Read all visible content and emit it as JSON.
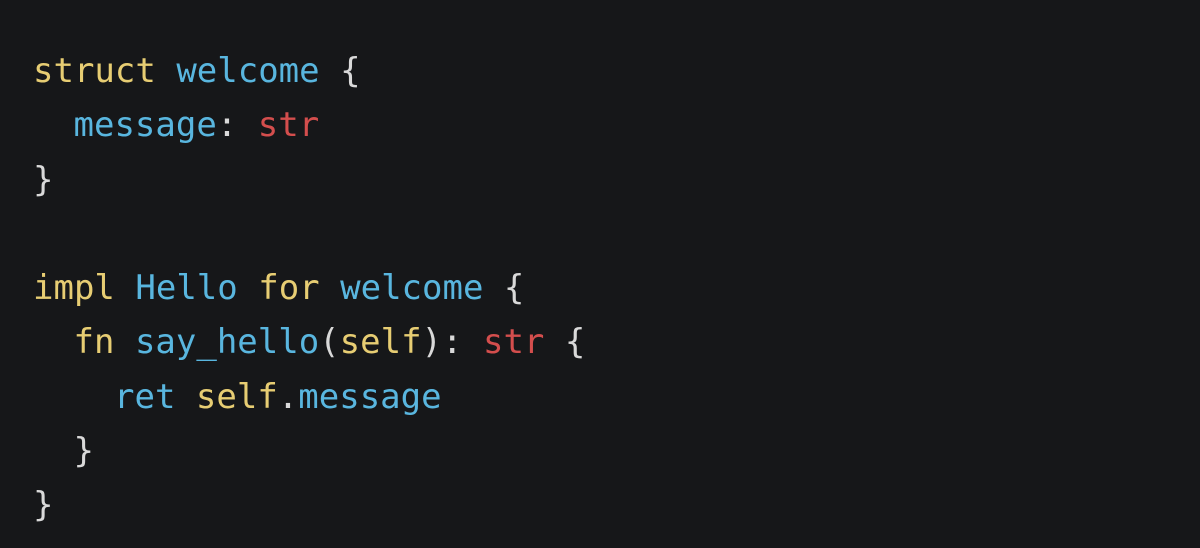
{
  "colors": {
    "background": "#161719",
    "keyword": "#e7cd73",
    "identifier": "#59b6df",
    "type": "#d44e4d",
    "punctuation": "#d9d9d9"
  },
  "code": {
    "line1": {
      "t1": "struct",
      "t2": "welcome",
      "t3": "{"
    },
    "line2": {
      "t1": "message",
      "t2": ":",
      "t3": "str"
    },
    "line3": {
      "t1": "}"
    },
    "line5": {
      "t1": "impl",
      "t2": "Hello",
      "t3": "for",
      "t4": "welcome",
      "t5": "{"
    },
    "line6": {
      "t1": "fn",
      "t2": "say_hello",
      "t3": "(",
      "t4": "self",
      "t5": "):",
      "t6": "str",
      "t7": "{"
    },
    "line7": {
      "t1": "ret",
      "t2": "self",
      "t3": ".",
      "t4": "message"
    },
    "line8": {
      "t1": "}"
    },
    "line9": {
      "t1": "}"
    }
  }
}
